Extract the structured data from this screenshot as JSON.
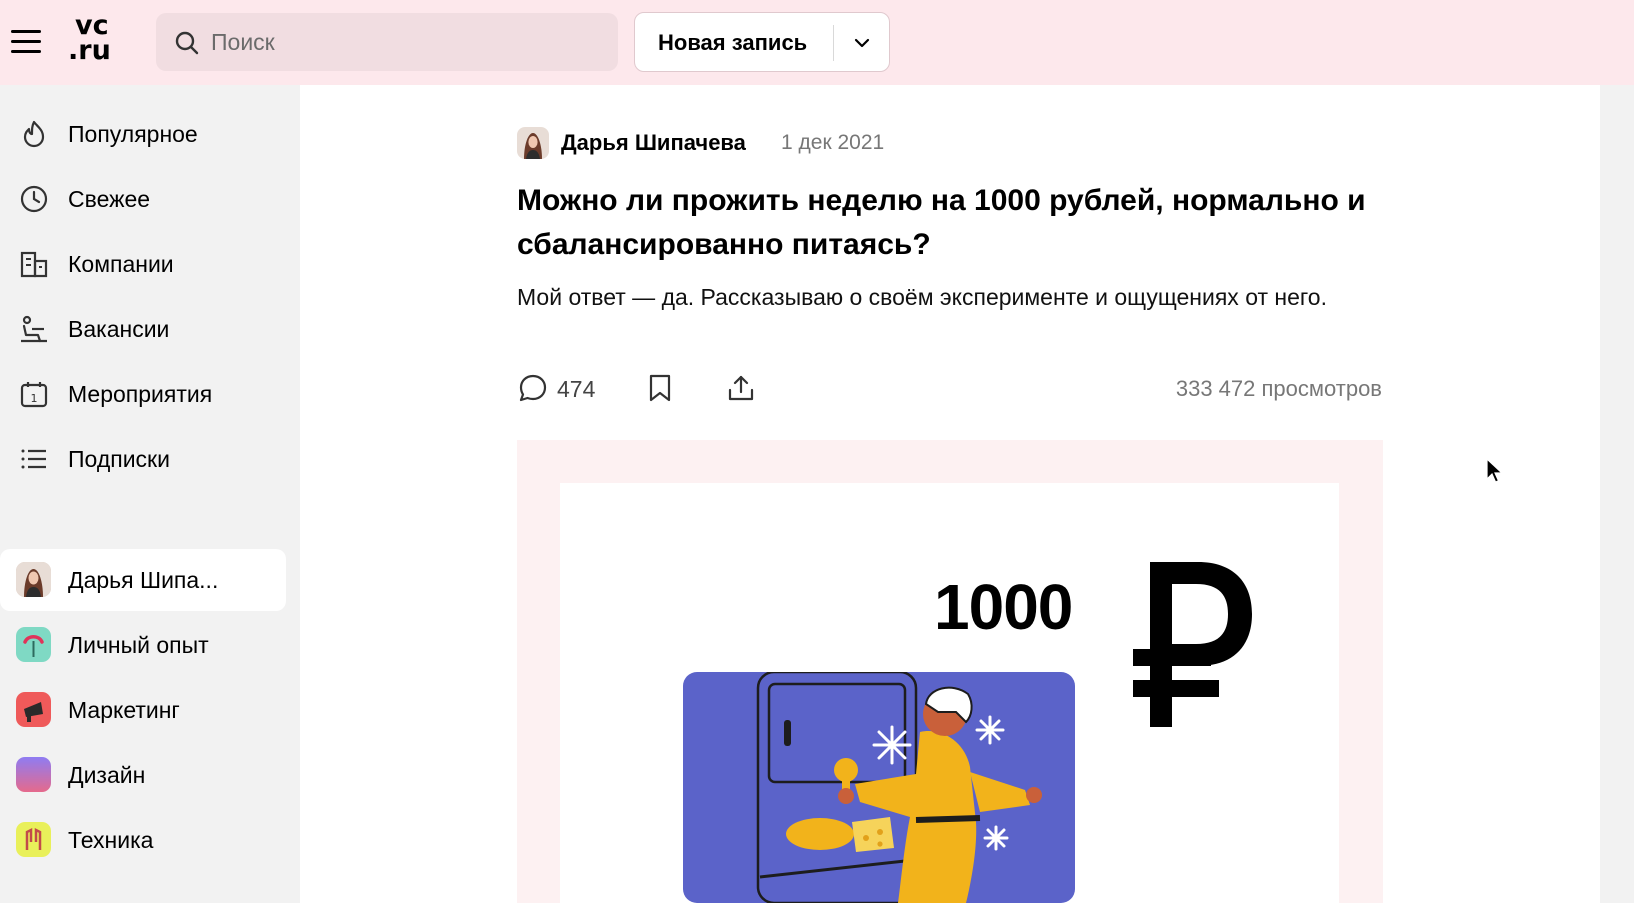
{
  "header": {
    "logo_line1": "vc",
    "logo_line2": ".ru",
    "search_placeholder": "Поиск",
    "new_post_label": "Новая запись"
  },
  "sidebar": {
    "nav": [
      {
        "label": "Популярное",
        "icon": "flame-icon"
      },
      {
        "label": "Свежее",
        "icon": "clock-icon"
      },
      {
        "label": "Компании",
        "icon": "buildings-icon"
      },
      {
        "label": "Вакансии",
        "icon": "job-seat-icon"
      },
      {
        "label": "Мероприятия",
        "icon": "calendar-icon"
      },
      {
        "label": "Подписки",
        "icon": "list-icon"
      }
    ],
    "subscriptions": [
      {
        "label": "Дарья Шипа...",
        "icon": "user-avatar",
        "active": true
      },
      {
        "label": "Личный опыт",
        "icon": "personal-experience-tile",
        "color": "#7fd9c4"
      },
      {
        "label": "Маркетинг",
        "icon": "megaphone-tile",
        "color": "#ef5a5a"
      },
      {
        "label": "Дизайн",
        "icon": "gradient-tile",
        "color": "#9b7cf0"
      },
      {
        "label": "Техника",
        "icon": "tech-tile",
        "color": "#e9f05a"
      }
    ]
  },
  "post": {
    "author": "Дарья Шипачева",
    "date": "1 дек 2021",
    "title": "Можно ли прожить неделю на 1000 рублей, нормально и сбалансированно питаясь?",
    "lead": "Мой ответ — да. Рассказываю о своём эксперименте и ощущениях от него.",
    "comments_count": "474",
    "views": "333 472 просмотров",
    "cover": {
      "amount_text": "1000",
      "currency_symbol": "₽"
    }
  },
  "colors": {
    "header_bg": "#fde8ec",
    "search_bg": "#f1dde1",
    "cover_blue": "#5b63c9",
    "cover_yellow": "#f2b31b"
  }
}
